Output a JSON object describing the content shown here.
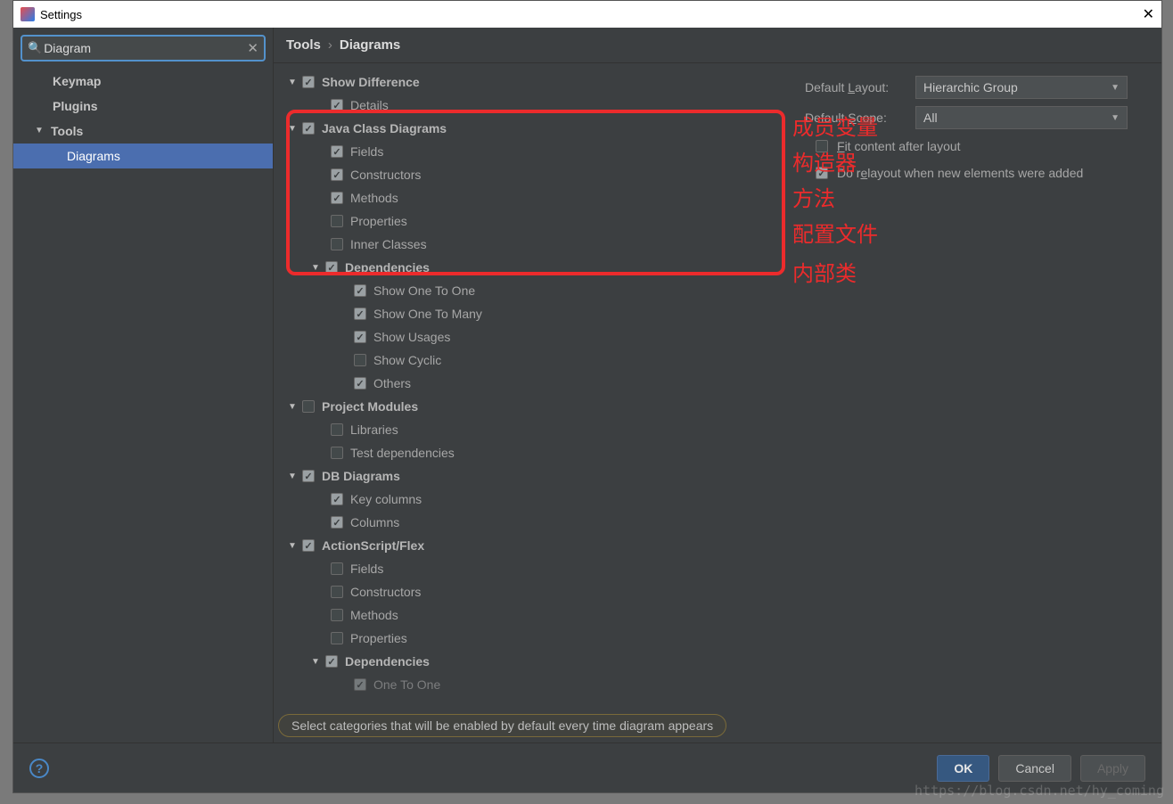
{
  "window": {
    "title": "Settings"
  },
  "sidebar": {
    "search_value": "Diagram",
    "items": {
      "keymap": "Keymap",
      "plugins": "Plugins",
      "tools": "Tools",
      "diagrams": "Diagrams"
    }
  },
  "breadcrumb": {
    "a": "Tools",
    "b": "Diagrams"
  },
  "tree": {
    "show_difference": "Show Difference",
    "details": "Details",
    "java_class_diagrams": "Java Class Diagrams",
    "fields": "Fields",
    "constructors": "Constructors",
    "methods": "Methods",
    "properties": "Properties",
    "inner_classes": "Inner Classes",
    "dependencies": "Dependencies",
    "show_one_to_one": "Show One To One",
    "show_one_to_many": "Show One To Many",
    "show_usages": "Show Usages",
    "show_cyclic": "Show Cyclic",
    "others": "Others",
    "project_modules": "Project Modules",
    "libraries": "Libraries",
    "test_dependencies": "Test dependencies",
    "db_diagrams": "DB Diagrams",
    "key_columns": "Key columns",
    "columns": "Columns",
    "actionscript_flex": "ActionScript/Flex",
    "as_fields": "Fields",
    "as_constructors": "Constructors",
    "as_methods": "Methods",
    "as_properties": "Properties",
    "as_dependencies": "Dependencies",
    "as_one_to_one": "One To One"
  },
  "annotations": {
    "a1": "成员变量",
    "a2": "构造器",
    "a3": "方法",
    "a4": "配置文件",
    "a5": "内部类"
  },
  "right": {
    "layout_label": "Default Layout:",
    "layout_value": "Hierarchic Group",
    "scope_label": "Default Scope:",
    "scope_value": "All",
    "fit": "Fit content after layout",
    "relayout": "Do relayout when new elements were added"
  },
  "hint": "Select categories that will be enabled by default every time diagram appears",
  "footer": {
    "ok": "OK",
    "cancel": "Cancel",
    "apply": "Apply"
  },
  "watermark": "https://blog.csdn.net/hy_coming"
}
